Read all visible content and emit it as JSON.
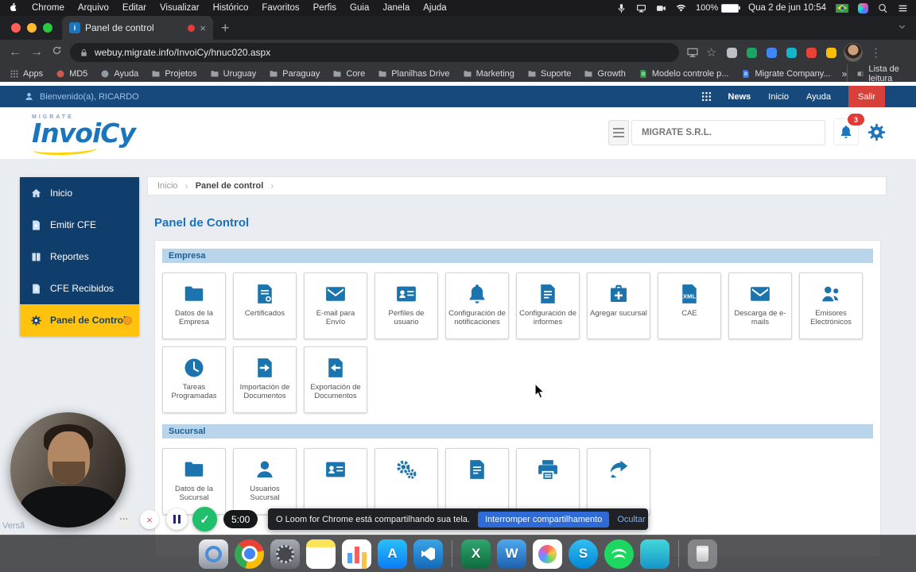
{
  "menubar": {
    "items": [
      "Chrome",
      "Arquivo",
      "Editar",
      "Visualizar",
      "Histórico",
      "Favoritos",
      "Perfis",
      "Guia",
      "Janela",
      "Ajuda"
    ],
    "status": {
      "battery": "100%",
      "datetime": "Qua 2 de jun 10:54"
    }
  },
  "browser": {
    "tab_title": "Panel de control",
    "url": "webuy.migrate.info/InvoiCy/hnuc020.aspx",
    "favicon_letter": "i",
    "new_tab": "+",
    "icons": {
      "back": "←",
      "forward": "→",
      "star": "☆",
      "menu": "⋮",
      "close": "×"
    },
    "bookmarks": [
      {
        "label": "Apps",
        "icon": "apps-grid",
        "color": "#9aa0a6"
      },
      {
        "label": "MD5",
        "icon": "circle",
        "color": "#c95b4f"
      },
      {
        "label": "Ayuda",
        "icon": "circle",
        "color": "#8f9aa6"
      },
      {
        "label": "Projetos",
        "icon": "folder",
        "color": "#9aa0a6"
      },
      {
        "label": "Uruguay",
        "icon": "folder",
        "color": "#9aa0a6"
      },
      {
        "label": "Paraguay",
        "icon": "folder",
        "color": "#9aa0a6"
      },
      {
        "label": "Core",
        "icon": "folder",
        "color": "#9aa0a6"
      },
      {
        "label": "Planilhas Drive",
        "icon": "folder",
        "color": "#9aa0a6"
      },
      {
        "label": "Marketing",
        "icon": "folder",
        "color": "#9aa0a6"
      },
      {
        "label": "Suporte",
        "icon": "folder",
        "color": "#9aa0a6"
      },
      {
        "label": "Growth",
        "icon": "folder",
        "color": "#9aa0a6"
      },
      {
        "label": "Modelo controle p...",
        "icon": "sheet",
        "color": "#34a853"
      },
      {
        "label": "Migrate Company...",
        "icon": "sheet",
        "color": "#4285f4"
      }
    ],
    "bookmarks_overflow": "»",
    "reading_list": "Lista de leitura",
    "extensions": [
      {
        "color": "#bdc1c6"
      },
      {
        "color": "#1da462"
      },
      {
        "color": "#4285f4"
      },
      {
        "color": "#12b5cb"
      },
      {
        "color": "#ea4335"
      },
      {
        "color": "#fbbc04"
      }
    ]
  },
  "app": {
    "topbar": {
      "welcome": "Bienvenido(a), RICARDO",
      "links": [
        {
          "label": "News",
          "strong": true
        },
        {
          "label": "Inicio"
        },
        {
          "label": "Ayuda"
        },
        {
          "label": "Salir",
          "danger": true
        }
      ]
    },
    "header": {
      "brand_small": "MIGRATE",
      "brand": "InvoiCy",
      "company": "MIGRATE S.R.L.",
      "notification_count": "3"
    },
    "sidebar": [
      {
        "label": "Inicio",
        "icon": "home"
      },
      {
        "label": "Emitir CFE",
        "icon": "send"
      },
      {
        "label": "Reportes",
        "icon": "book"
      },
      {
        "label": "CFE Recibidos",
        "icon": "inbox"
      },
      {
        "label": "Panel de Control",
        "icon": "gear",
        "active": true
      }
    ],
    "breadcrumb": [
      "Inicio",
      "Panel de control"
    ],
    "page_title": "Panel de Control",
    "sections": [
      {
        "title": "Empresa",
        "tiles": [
          {
            "label": "Datos de la Empresa",
            "icon": "folder"
          },
          {
            "label": "Certificados",
            "icon": "certificate"
          },
          {
            "label": "E-mail para Envío",
            "icon": "envelope"
          },
          {
            "label": "Perfiles de usuario",
            "icon": "id-card"
          },
          {
            "label": "Configuración de notificaciones",
            "icon": "bell"
          },
          {
            "label": "Configuración de informes",
            "icon": "report"
          },
          {
            "label": "Agregar sucursal",
            "icon": "add-branch"
          },
          {
            "label": "CAE",
            "icon": "xml"
          },
          {
            "label": "Descarga de e-mails",
            "icon": "envelope"
          },
          {
            "label": "Emisores Electrónicos",
            "icon": "users"
          },
          {
            "label": "Tareas Programadas",
            "icon": "clock"
          },
          {
            "label": "Importación de Documentos",
            "icon": "import"
          },
          {
            "label": "Exportación de Documentos",
            "icon": "export"
          }
        ]
      },
      {
        "title": "Sucursal",
        "tiles": [
          {
            "label": "Datos de la Sucursal",
            "icon": "folder"
          },
          {
            "label": "Usuarios Sucursal",
            "icon": "user"
          },
          {
            "label": "",
            "icon": "id-card"
          },
          {
            "label": "",
            "icon": "gears"
          },
          {
            "label": "",
            "icon": "report"
          },
          {
            "label": "",
            "icon": "printer"
          },
          {
            "label": "",
            "icon": "share"
          }
        ]
      }
    ],
    "version": "Versã"
  },
  "loom": {
    "more_label": "···",
    "close_label": "×",
    "check_label": "✓",
    "timer": "5:00",
    "message": "O Loom for Chrome está compartilhando sua tela.",
    "stop_button": "Interromper compartilhamento",
    "hide_link": "Ocultar"
  },
  "dock": {
    "items": [
      {
        "name": "quicktime",
        "glyph": ""
      },
      {
        "name": "chrome",
        "glyph": ""
      },
      {
        "name": "settings",
        "glyph": ""
      },
      {
        "name": "notes",
        "glyph": ""
      },
      {
        "name": "stats",
        "glyph": ""
      },
      {
        "name": "appstore",
        "glyph": "A"
      },
      {
        "name": "vscode",
        "glyph": ""
      },
      {
        "name": "divider",
        "glyph": ""
      },
      {
        "name": "excel",
        "glyph": "X"
      },
      {
        "name": "word",
        "glyph": "W"
      },
      {
        "name": "photos",
        "glyph": ""
      },
      {
        "name": "skype",
        "glyph": "S"
      },
      {
        "name": "spotify",
        "glyph": ""
      },
      {
        "name": "teal-app",
        "glyph": ""
      },
      {
        "name": "divider",
        "glyph": ""
      },
      {
        "name": "trash",
        "glyph": ""
      }
    ]
  }
}
